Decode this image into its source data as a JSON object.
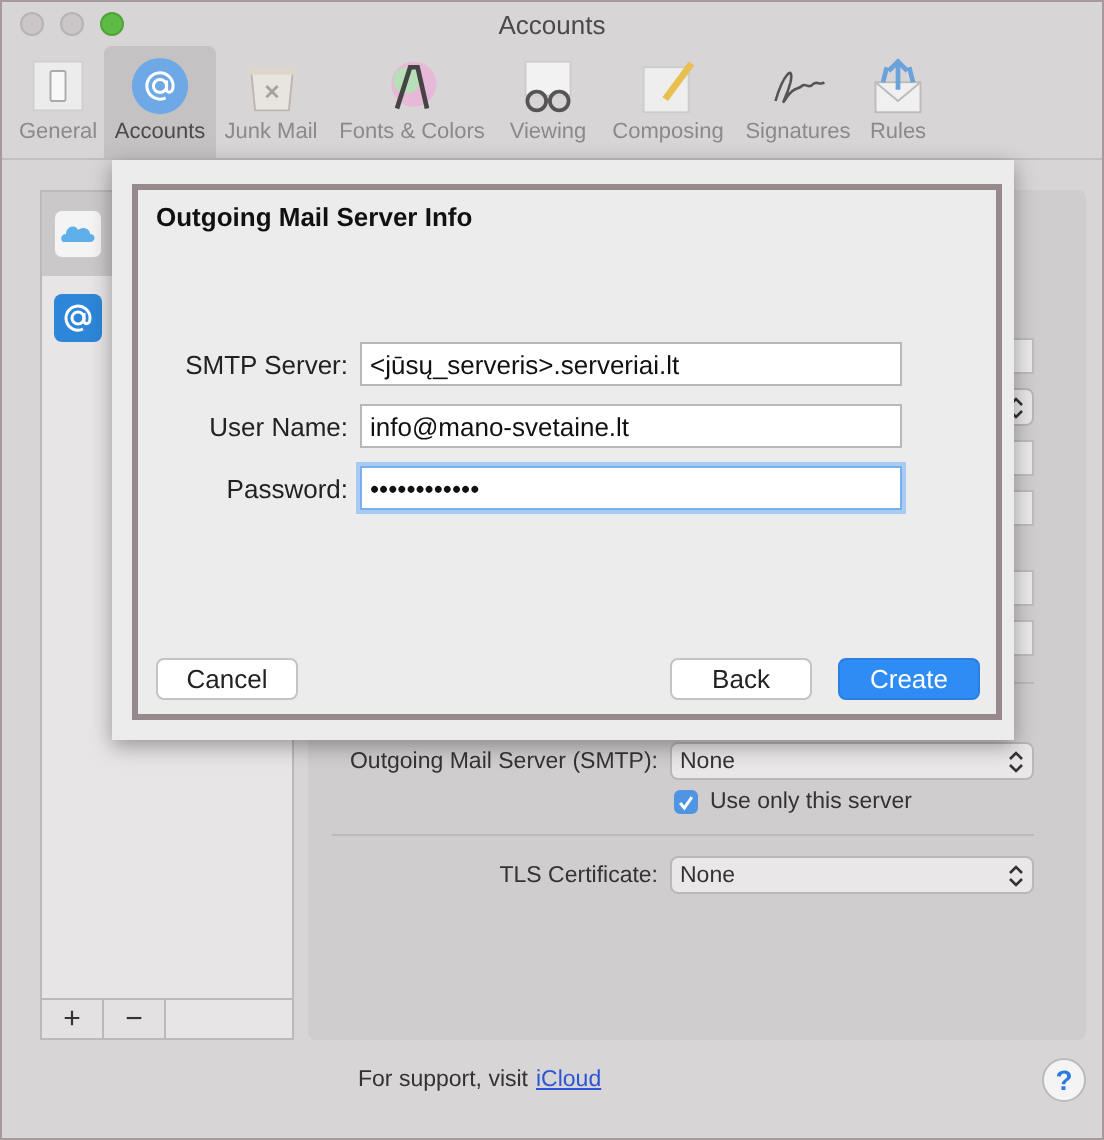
{
  "window": {
    "title": "Accounts"
  },
  "toolbar": [
    {
      "label": "General",
      "kind": "general",
      "selected": false
    },
    {
      "label": "Accounts",
      "kind": "accounts",
      "selected": true
    },
    {
      "label": "Junk Mail",
      "kind": "junk",
      "selected": false
    },
    {
      "label": "Fonts & Colors",
      "kind": "fonts",
      "selected": false
    },
    {
      "label": "Viewing",
      "kind": "viewing",
      "selected": false
    },
    {
      "label": "Composing",
      "kind": "composing",
      "selected": false
    },
    {
      "label": "Signatures",
      "kind": "signatures",
      "selected": false
    },
    {
      "label": "Rules",
      "kind": "rules",
      "selected": false
    }
  ],
  "sidebar": {
    "accounts": [
      {
        "kind": "cloud",
        "selected": true
      },
      {
        "kind": "email",
        "selected": false
      }
    ],
    "buttons": [
      "+",
      "−"
    ]
  },
  "settings": {
    "hidden_fields": [
      {
        "kind": "text"
      },
      {
        "kind": "select"
      },
      {
        "kind": "text"
      },
      {
        "kind": "text"
      },
      {
        "kind": "gap"
      },
      {
        "kind": "text"
      },
      {
        "kind": "text"
      }
    ],
    "smtp": {
      "label": "Outgoing Mail Server (SMTP):",
      "value": "None"
    },
    "use_only": {
      "label": "Use only this server",
      "checked": true
    },
    "tls": {
      "label": "TLS Certificate:",
      "value": "None"
    }
  },
  "support": {
    "text": "For support, visit",
    "link": "iCloud"
  },
  "help": "?",
  "sheet": {
    "title": "Outgoing Mail Server Info",
    "fields": [
      {
        "label": "SMTP Server:",
        "value": "<jūsų_serveris>.serveriai.lt",
        "focused": false
      },
      {
        "label": "User Name:",
        "value": "info@mano-svetaine.lt",
        "focused": false
      },
      {
        "label": "Password:",
        "value": "••••••••••••",
        "focused": true
      }
    ],
    "buttons": [
      {
        "label": "Cancel",
        "default": false
      },
      {
        "label": "Back",
        "default": false
      },
      {
        "label": "Create",
        "default": true
      }
    ]
  }
}
